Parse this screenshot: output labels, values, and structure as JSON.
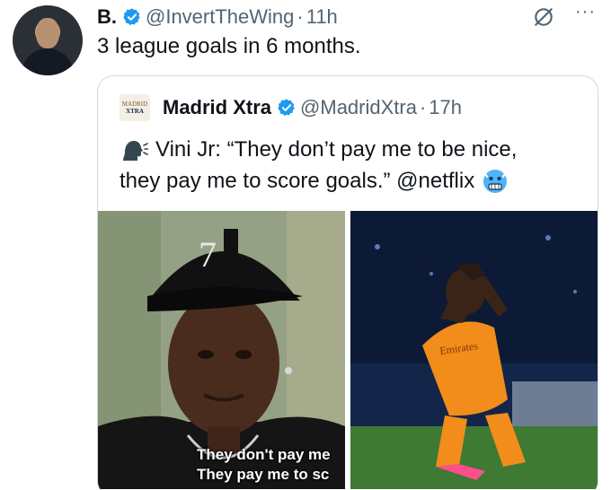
{
  "tweet": {
    "author_name": "B.",
    "handle": "@InvertTheWing",
    "separator": "·",
    "time": "11h",
    "text": "3 league goals in 6 months.",
    "more_label": "···"
  },
  "quote": {
    "logo_line1": "MADRID",
    "logo_line2": "XTRA",
    "author_name": "Madrid Xtra",
    "handle": "@MadridXtra",
    "separator": "·",
    "time": "17h",
    "text_line1": "Vini Jr: “They don’t pay me to be nice,",
    "text_line2": "they pay me to score goals.” @netflix",
    "emoji_before": "speaking-head",
    "emoji_after": "cold-face",
    "media": {
      "caption_line1": "They don't pay me",
      "caption_line2": "They pay me to sc",
      "cap_number": "7",
      "jersey_text": "Emirates"
    }
  },
  "colors": {
    "verified": "#1d9bf0",
    "secondary_text": "#536471",
    "border": "#cfd9de"
  }
}
